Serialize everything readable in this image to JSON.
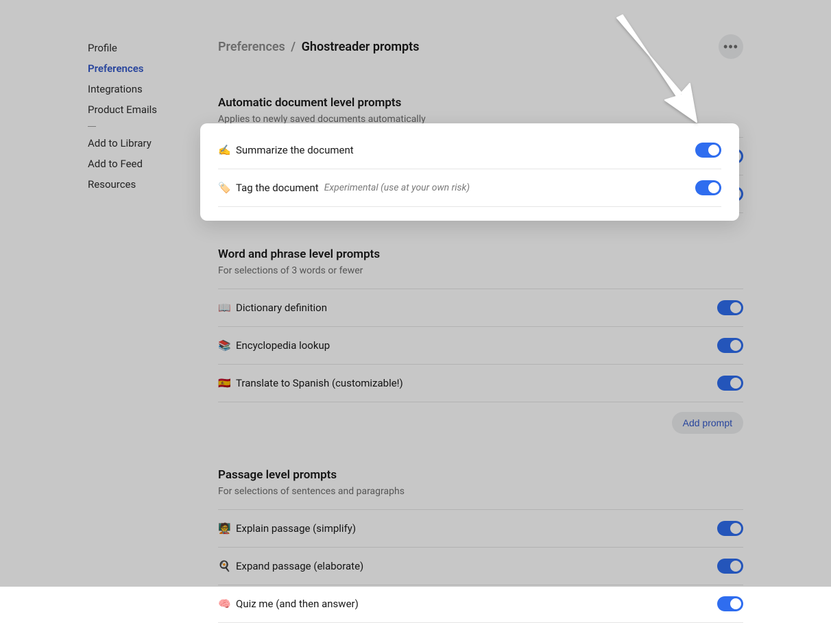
{
  "sidebar": {
    "items": [
      {
        "label": "Profile",
        "active": false
      },
      {
        "label": "Preferences",
        "active": true
      },
      {
        "label": "Integrations",
        "active": false
      },
      {
        "label": "Product Emails",
        "active": false
      }
    ],
    "items2": [
      {
        "label": "Add to Library"
      },
      {
        "label": "Add to Feed"
      },
      {
        "label": "Resources"
      }
    ]
  },
  "header": {
    "breadcrumb_parent": "Preferences",
    "breadcrumb_sep": "/",
    "breadcrumb_current": "Ghostreader prompts"
  },
  "sections": {
    "auto": {
      "title": "Automatic document level prompts",
      "subtitle": "Applies to newly saved documents automatically",
      "prompts": [
        {
          "emoji": "✍️",
          "label": "Summarize the document",
          "badge": "",
          "on": true
        },
        {
          "emoji": "🏷️",
          "label": "Tag the document",
          "badge": "Experimental (use at your own risk)",
          "on": true
        }
      ]
    },
    "word": {
      "title": "Word and phrase level prompts",
      "subtitle": "For selections of 3 words or fewer",
      "prompts": [
        {
          "emoji": "📖",
          "label": "Dictionary definition",
          "on": true
        },
        {
          "emoji": "📚",
          "label": "Encyclopedia lookup",
          "on": true
        },
        {
          "emoji": "🇪🇸",
          "label": "Translate to Spanish (customizable!)",
          "on": true
        }
      ],
      "add_label": "Add prompt"
    },
    "passage": {
      "title": "Passage level prompts",
      "subtitle": "For selections of sentences and paragraphs",
      "prompts": [
        {
          "emoji": "🧑‍🏫",
          "label": "Explain passage (simplify)",
          "on": true
        },
        {
          "emoji": "🍳",
          "label": "Expand passage (elaborate)",
          "on": true
        },
        {
          "emoji": "🧠",
          "label": "Quiz me (and then answer)",
          "on": true
        }
      ]
    }
  }
}
